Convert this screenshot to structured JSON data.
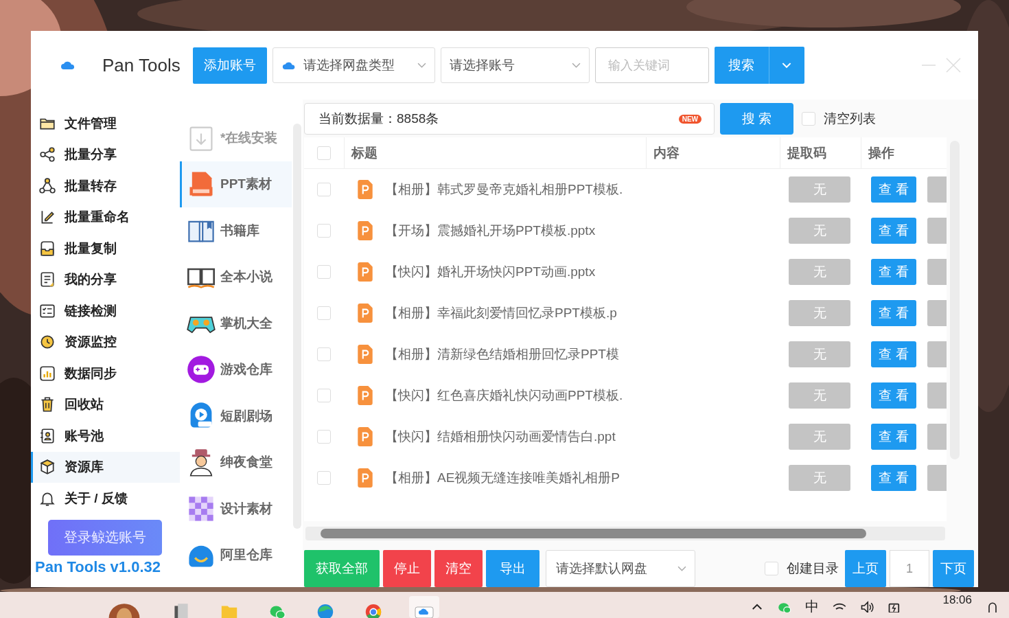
{
  "window": {
    "app_name": "Pan Tools",
    "version": "Pan Tools v1.0.32"
  },
  "toolbar": {
    "add_account": "添加账号",
    "disk_type": {
      "placeholder": "请选择网盘类型"
    },
    "account": {
      "placeholder": "请选择账号"
    },
    "keyword": {
      "placeholder": "输入关键词"
    },
    "search": "搜索"
  },
  "sidebar": {
    "items": [
      {
        "label": "文件管理",
        "selected": false
      },
      {
        "label": "批量分享",
        "selected": false
      },
      {
        "label": "批量转存",
        "selected": false
      },
      {
        "label": "批量重命名",
        "selected": false
      },
      {
        "label": "批量复制",
        "selected": false
      },
      {
        "label": "我的分享",
        "selected": false
      },
      {
        "label": "链接检测",
        "selected": false
      },
      {
        "label": "资源监控",
        "selected": false
      },
      {
        "label": "数据同步",
        "selected": false
      },
      {
        "label": "回收站",
        "selected": false
      },
      {
        "label": "账号池",
        "selected": false
      },
      {
        "label": "资源库",
        "selected": true
      },
      {
        "label": "关于 / 反馈",
        "selected": false
      }
    ],
    "login_button": "登录鲸选账号"
  },
  "categories": [
    {
      "label": "*在线安装",
      "selected": false,
      "disabled": true
    },
    {
      "label": "PPT素材",
      "selected": true,
      "disabled": false
    },
    {
      "label": "书籍库",
      "selected": false,
      "disabled": false
    },
    {
      "label": "全本小说",
      "selected": false,
      "disabled": false
    },
    {
      "label": "掌机大全",
      "selected": false,
      "disabled": false
    },
    {
      "label": "游戏仓库",
      "selected": false,
      "disabled": false
    },
    {
      "label": "短剧剧场",
      "selected": false,
      "disabled": false
    },
    {
      "label": "绅夜食堂",
      "selected": false,
      "disabled": false
    },
    {
      "label": "设计素材",
      "selected": false,
      "disabled": false
    },
    {
      "label": "阿里仓库",
      "selected": false,
      "disabled": false
    }
  ],
  "data_bar": {
    "count_text": "当前数据量：8858条",
    "badge": "NEW",
    "search": "搜 索",
    "clear_list": {
      "label": "清空列表",
      "checked": false
    }
  },
  "table": {
    "columns": [
      "标题",
      "内容",
      "提取码",
      "操作"
    ],
    "all_checked": false,
    "rows": [
      {
        "title": "【相册】韩式罗曼帝克婚礼相册PPT模板.",
        "code": "无",
        "action": "查 看",
        "checked": false
      },
      {
        "title": "【开场】震撼婚礼开场PPT模板.pptx",
        "code": "无",
        "action": "查 看",
        "checked": false
      },
      {
        "title": "【快闪】婚礼开场快闪PPT动画.pptx",
        "code": "无",
        "action": "查 看",
        "checked": false
      },
      {
        "title": "【相册】幸福此刻爱情回忆录PPT模板.p",
        "code": "无",
        "action": "查 看",
        "checked": false
      },
      {
        "title": "【相册】清新绿色结婚相册回忆录PPT模",
        "code": "无",
        "action": "查 看",
        "checked": false
      },
      {
        "title": "【快闪】红色喜庆婚礼快闪动画PPT模板.",
        "code": "无",
        "action": "查 看",
        "checked": false
      },
      {
        "title": "【快闪】结婚相册快闪动画爱情告白.ppt",
        "code": "无",
        "action": "查 看",
        "checked": false
      },
      {
        "title": "【相册】AE视频无缝连接唯美婚礼相册P",
        "code": "无",
        "action": "查 看",
        "checked": false
      }
    ]
  },
  "bottom_bar": {
    "buttons": [
      {
        "label": "获取全部",
        "kind": "success"
      },
      {
        "label": "停止",
        "kind": "danger"
      },
      {
        "label": "清空",
        "kind": "danger"
      },
      {
        "label": "导出",
        "kind": "primary"
      }
    ],
    "default_disk": {
      "placeholder": "请选择默认网盘"
    },
    "create_dir": {
      "label": "创建目录",
      "checked": false
    },
    "prev": "上页",
    "page": "1",
    "next": "下页"
  },
  "taskbar": {
    "language": "中",
    "time": "18:06"
  }
}
